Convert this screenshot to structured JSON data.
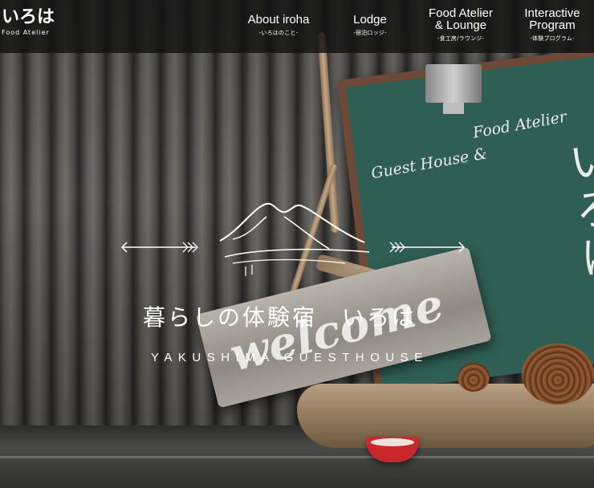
{
  "site": {
    "logo_main": "いろは",
    "logo_sub": "Food Atelier"
  },
  "nav": {
    "items": [
      {
        "label": "About iroha",
        "sub": "-いろはのこと-"
      },
      {
        "label": "Lodge",
        "sub": "-宿泊ロッジ-"
      },
      {
        "label": "Food Atelier\n& Lounge",
        "sub": "-食工房/ラウンジ-"
      },
      {
        "label": "Interactive\nProgram",
        "sub": "-体験プログラム-"
      }
    ]
  },
  "hero": {
    "catch_copy": "暮らしの体験宿　いろは",
    "brand_en": "YAKUSHIMA GUESTHOUSE",
    "photo_elements": {
      "board_text_1": "Guest House &",
      "board_text_2": "Food Atelier",
      "board_text_big": "いろは",
      "sign_text": "welcome"
    }
  },
  "colors": {
    "header_bg": "#121212",
    "text": "#ffffff",
    "chalkboard": "#2f5e55",
    "board_frame": "#6d4a38",
    "bowl": "#c8272b"
  }
}
